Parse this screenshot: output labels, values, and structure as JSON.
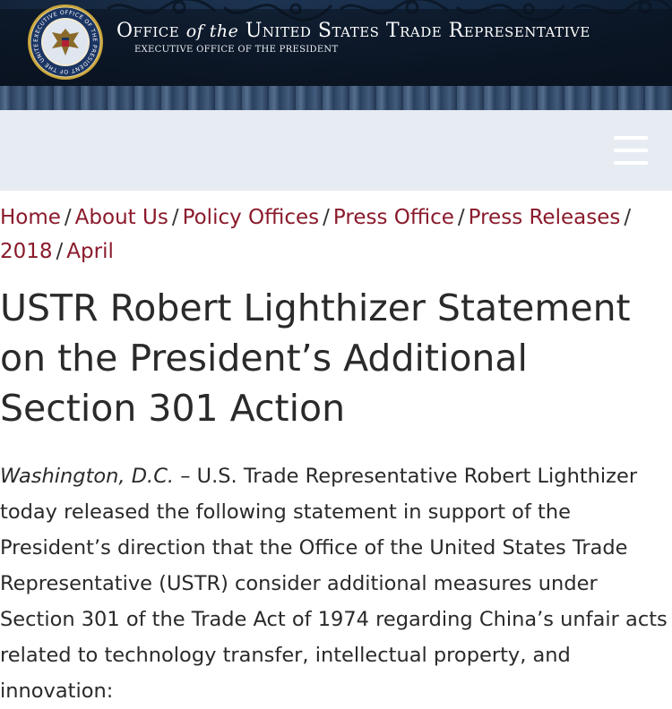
{
  "header": {
    "title_part1": "Office",
    "title_of_the": "of the",
    "title_part2": "United States Trade Representative",
    "subtitle": "EXECUTIVE OFFICE OF THE PRESIDENT",
    "seal_text": "EXECUTIVE OFFICE OF THE PRESIDENT OF THE UNITED STATES",
    "seal_icon": "presidential-seal-icon",
    "colors": {
      "banner": "#13243a",
      "title_text": "#ffffff"
    }
  },
  "nav": {
    "menu_icon": "hamburger-menu-icon",
    "colors": {
      "bar": "#e7ebf2",
      "icon": "#ffffff"
    }
  },
  "breadcrumb": {
    "items": [
      "Home",
      "About Us",
      "Policy Offices",
      "Press Office",
      "Press Releases",
      "2018",
      "April"
    ],
    "separator": "/",
    "colors": {
      "link": "#8a1a2b"
    }
  },
  "article": {
    "title": "USTR Robert Lighthizer Statement on the President’s Additional Section 301 Action",
    "dateline": "Washington, D.C.",
    "dash": "–",
    "body": "U.S. Trade Representative Robert Lighthizer today released the following statement in support of the President’s direction that the Office of the United States Trade Representative (USTR) consider additional measures under Section 301 of the Trade Act of 1974 regarding China’s unfair acts related to technology transfer, intellectual property, and innovation:"
  }
}
